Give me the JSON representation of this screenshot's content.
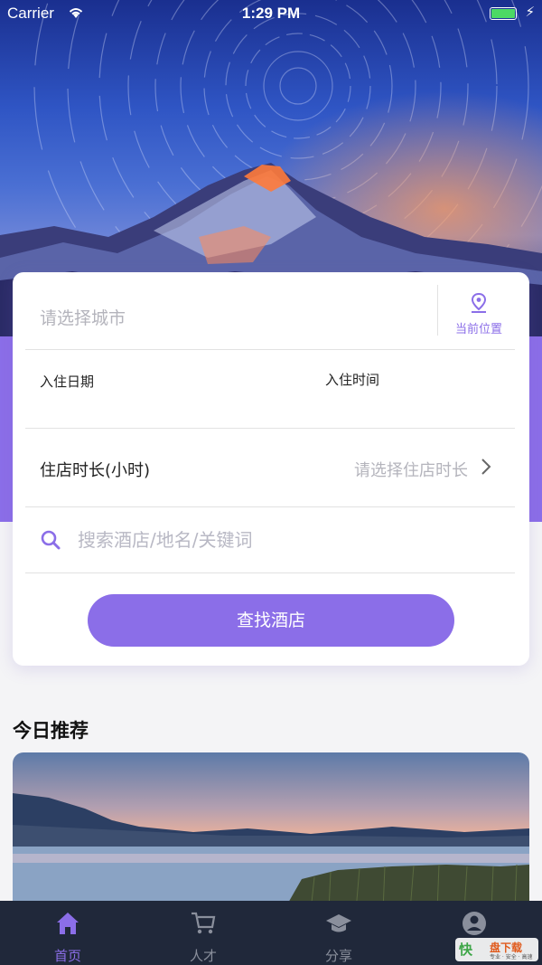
{
  "status_bar": {
    "carrier": "Carrier",
    "time": "1:29 PM"
  },
  "search_form": {
    "city_placeholder": "请选择城市",
    "current_location_label": "当前位置",
    "checkin_date_label": "入住日期",
    "checkin_time_label": "入住时间",
    "duration_label": "住店时长(小时)",
    "duration_placeholder": "请选择住店时长",
    "search_placeholder": "搜索酒店/地名/关键词",
    "find_button_label": "查找酒店"
  },
  "recommend": {
    "title": "今日推荐"
  },
  "tabbar": {
    "tabs": [
      {
        "label": "首页",
        "icon": "home-icon",
        "active": true
      },
      {
        "label": "人才",
        "icon": "cart-icon",
        "active": false
      },
      {
        "label": "分享",
        "icon": "graduation-cap-icon",
        "active": false
      },
      {
        "label": "",
        "icon": "user-circle-icon",
        "active": false
      }
    ]
  },
  "watermark": {
    "brand": "快",
    "name": "盘下载",
    "slogan": "专业 · 安全 · 高速"
  },
  "colors": {
    "accent": "#8b6ee8",
    "tabbar_bg": "#20283a",
    "placeholder": "#b4b4bc"
  }
}
